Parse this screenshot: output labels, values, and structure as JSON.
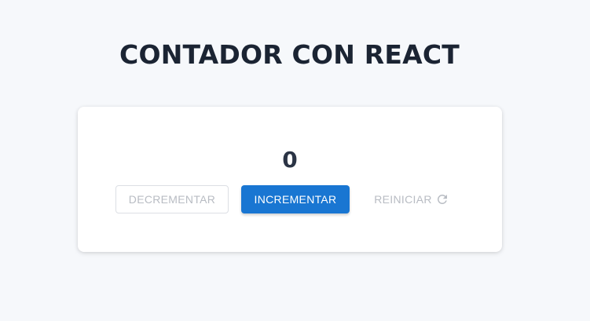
{
  "header": {
    "title": "CONTADOR CON REACT"
  },
  "counter": {
    "value": "0",
    "decrement_label": "DECREMENTAR",
    "increment_label": "INCREMENTAR",
    "reset_label": "REINICIAR",
    "reset_icon": "refresh-icon"
  },
  "colors": {
    "background": "#f6f8fb",
    "title": "#1b2433",
    "primary": "#1976d2",
    "disabled_text": "#b8bcc3",
    "card": "#ffffff"
  }
}
